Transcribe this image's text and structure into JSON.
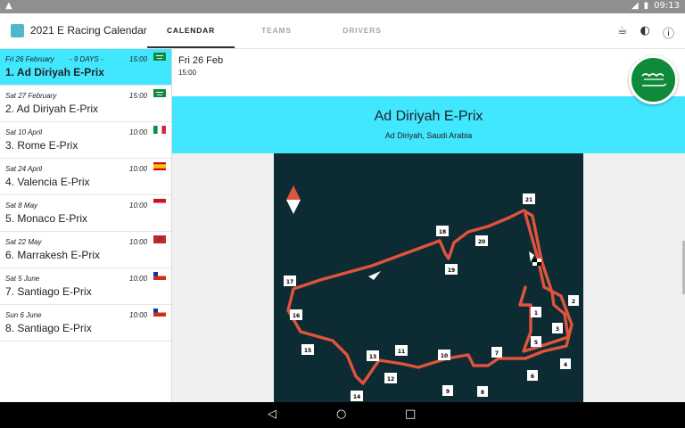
{
  "status": {
    "time": "09:13",
    "icons": [
      "warning-icon",
      "wifi-icon",
      "battery-icon"
    ]
  },
  "app": {
    "title": "2021 E Racing Calendar"
  },
  "tabs": [
    {
      "label": "CALENDAR",
      "active": true
    },
    {
      "label": "TEAMS",
      "active": false
    },
    {
      "label": "DRIVERS",
      "active": false
    }
  ],
  "actions": [
    "coffee-icon",
    "theme-icon",
    "info-icon"
  ],
  "races": [
    {
      "date": "Fri 26 February",
      "countdown": "- 9 DAYS -",
      "time": "15:00",
      "name": "1. Ad Diriyah E-Prix",
      "flag": "saudi-arabia",
      "selected": true
    },
    {
      "date": "Sat 27 February",
      "countdown": "",
      "time": "15:00",
      "name": "2. Ad Diriyah E-Prix",
      "flag": "saudi-arabia",
      "selected": false
    },
    {
      "date": "Sat 10 April",
      "countdown": "",
      "time": "10:00",
      "name": "3. Rome E-Prix",
      "flag": "italy",
      "selected": false
    },
    {
      "date": "Sat 24 April",
      "countdown": "",
      "time": "10:00",
      "name": "4. Valencia E-Prix",
      "flag": "spain",
      "selected": false
    },
    {
      "date": "Sat 8 May",
      "countdown": "",
      "time": "10:00",
      "name": "5. Monaco E-Prix",
      "flag": "monaco",
      "selected": false
    },
    {
      "date": "Sat 22 May",
      "countdown": "",
      "time": "10:00",
      "name": "6. Marrakesh E-Prix",
      "flag": "morocco",
      "selected": false
    },
    {
      "date": "Sat 5 June",
      "countdown": "",
      "time": "10:00",
      "name": "7. Santiago E-Prix",
      "flag": "chile",
      "selected": false
    },
    {
      "date": "Sun 6 June",
      "countdown": "",
      "time": "10:00",
      "name": "8. Santiago E-Prix",
      "flag": "chile",
      "selected": false
    }
  ],
  "detail": {
    "date": "Fri 26 Feb",
    "time": "15:00",
    "title": "Ad Diriyah E-Prix",
    "location": "Ad Diriyah, Saudi Arabia"
  },
  "colors": {
    "accent": "#41e6ff",
    "track_bg": "#0d2b33",
    "track_line": "#e0533d"
  }
}
